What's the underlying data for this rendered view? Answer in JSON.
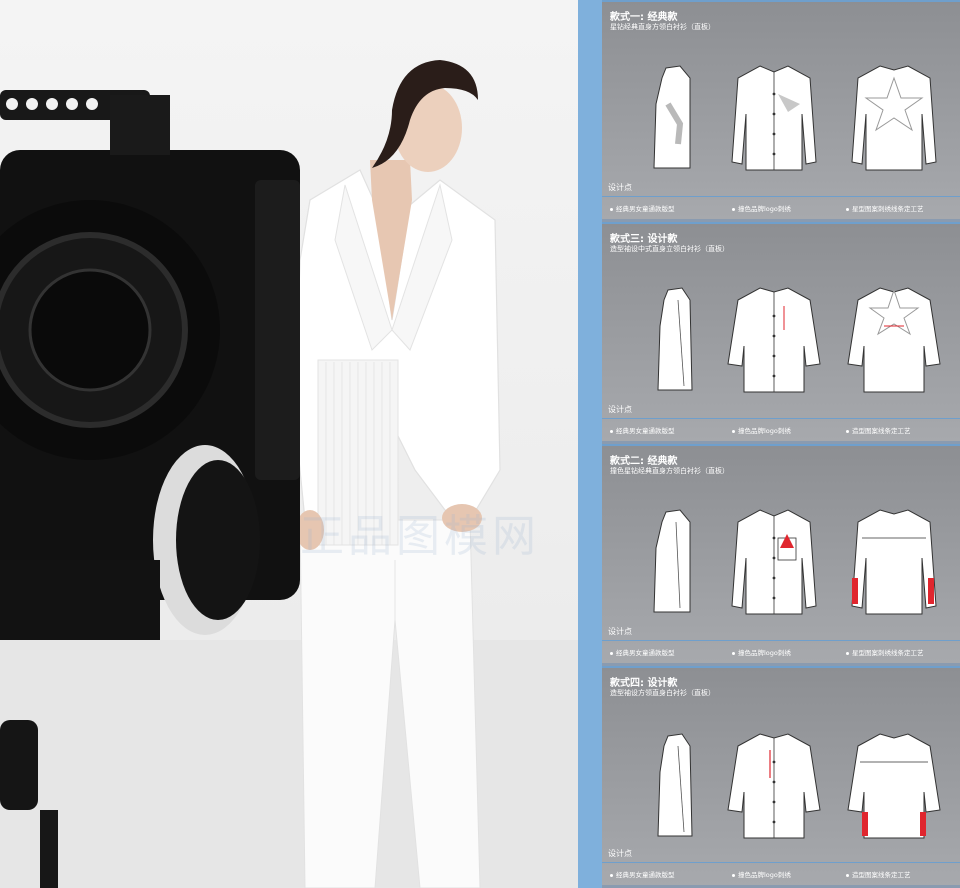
{
  "panels": [
    {
      "title": "款式一: 经典款",
      "subtitle": "星钻经典直身方领白衬衫（直板）",
      "design_label": "设计点",
      "features": [
        "经典男女童通款版型",
        "撞色品牌logo刺绣",
        "星型图案刺绣线条定工艺"
      ],
      "variant": "classic"
    },
    {
      "title": "款式三: 设计款",
      "subtitle": "造型袖设中式直身立领白衬衫（直板）",
      "design_label": "设计点",
      "features": [
        "经典男女童通款版型",
        "撞色品牌logo刺绣",
        "造型图案线条定工艺"
      ],
      "variant": "design3"
    },
    {
      "title": "款式二: 经典款",
      "subtitle": "撞色星钻经典直身方领白衬衫（直板）",
      "design_label": "设计点",
      "features": [
        "经典男女童通款版型",
        "撞色品牌logo刺绣",
        "星型图案刺绣线条定工艺"
      ],
      "variant": "classic2"
    },
    {
      "title": "款式四: 设计款",
      "subtitle": "造型袖设方领直身白衬衫（直板）",
      "design_label": "设计点",
      "features": [
        "经典男女童通款版型",
        "撞色品牌logo刺绣",
        "造型图案线条定工艺"
      ],
      "variant": "design4"
    }
  ],
  "watermark": "正品图模网",
  "colors": {
    "accent_blue": "#7fb0dc",
    "panel_gray": "#9a9ca0",
    "detail_red": "#e0262e"
  }
}
